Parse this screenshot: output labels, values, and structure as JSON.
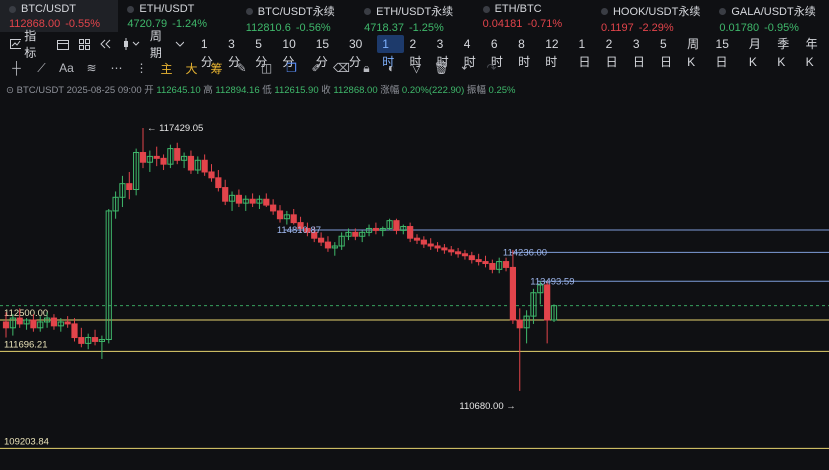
{
  "tickers": [
    {
      "symbol": "BTC/USDT",
      "price": "112868.00",
      "change": "-0.55%",
      "dir": "down",
      "active": true
    },
    {
      "symbol": "ETH/USDT",
      "price": "4720.79",
      "change": "-1.24%",
      "dir": "up",
      "active": false
    },
    {
      "symbol": "BTC/USDT永续",
      "price": "112810.6",
      "change": "-0.56%",
      "dir": "up",
      "active": false
    },
    {
      "symbol": "ETH/USDT永续",
      "price": "4718.37",
      "change": "-1.25%",
      "dir": "up",
      "active": false
    },
    {
      "symbol": "ETH/BTC",
      "price": "0.04181",
      "change": "-0.71%",
      "dir": "down",
      "active": false
    },
    {
      "symbol": "HOOK/USDT永续",
      "price": "0.1197",
      "change": "-2.29%",
      "dir": "down",
      "active": false
    },
    {
      "symbol": "GALA/USDT永续",
      "price": "0.01780",
      "change": "-0.95%",
      "dir": "up",
      "active": false
    }
  ],
  "periodbar": {
    "indicator_label": "指标",
    "period_label": "周期",
    "periods": [
      "1分",
      "3分",
      "5分",
      "10分",
      "15分",
      "30分",
      "1时",
      "2时",
      "3时",
      "4时",
      "6时",
      "8时",
      "12时",
      "1日",
      "2日",
      "3日",
      "5日",
      "周K",
      "15日",
      "月K",
      "季K",
      "年K"
    ],
    "active": "1时"
  },
  "toolbar": {
    "labels": [
      "Aa",
      "主",
      "大",
      "筹"
    ]
  },
  "ohlc": {
    "pair": "BTC/USDT",
    "time": "2025-08-25 09:00",
    "open_label": "开",
    "open": "112645.10",
    "high_label": "高",
    "high": "112894.16",
    "low_label": "低",
    "low": "112615.90",
    "close_label": "收",
    "close": "112868.00",
    "change_label": "涨幅",
    "change": "0.20%(222.90)",
    "amp_label": "振幅",
    "amp": "0.25%"
  },
  "chart_data": {
    "type": "candlestick",
    "ylim": [
      108650,
      118250
    ],
    "colors": {
      "up": "#3fb86b",
      "down": "#e2444b",
      "gold_line": "#e6d26f",
      "blue_line": "#7f9dd9"
    },
    "candles": [
      [
        112450,
        112700,
        112050,
        112300
      ],
      [
        112300,
        112650,
        112100,
        112550
      ],
      [
        112550,
        112800,
        112300,
        112400
      ],
      [
        112400,
        112550,
        112250,
        112500
      ],
      [
        112500,
        112650,
        112200,
        112300
      ],
      [
        112300,
        112600,
        112200,
        112450
      ],
      [
        112450,
        112700,
        112300,
        112550
      ],
      [
        112550,
        112650,
        112250,
        112350
      ],
      [
        112350,
        112550,
        112200,
        112450
      ],
      [
        112450,
        112600,
        112300,
        112400
      ],
      [
        112400,
        112550,
        111950,
        112050
      ],
      [
        112050,
        112300,
        111800,
        111900
      ],
      [
        111900,
        112150,
        111750,
        112050
      ],
      [
        112050,
        112250,
        111850,
        111950
      ],
      [
        111950,
        112100,
        111500,
        112000
      ],
      [
        112000,
        115350,
        111900,
        115300
      ],
      [
        115300,
        115800,
        115100,
        115650
      ],
      [
        115650,
        116200,
        115400,
        116000
      ],
      [
        116000,
        116300,
        115600,
        115850
      ],
      [
        115850,
        116900,
        115700,
        116800
      ],
      [
        116800,
        117429.05,
        116400,
        116550
      ],
      [
        116550,
        116850,
        116300,
        116700
      ],
      [
        116700,
        116950,
        116450,
        116650
      ],
      [
        116650,
        116750,
        116350,
        116500
      ],
      [
        116500,
        117000,
        116400,
        116900
      ],
      [
        116900,
        117050,
        116500,
        116600
      ],
      [
        116600,
        116800,
        116400,
        116700
      ],
      [
        116700,
        116850,
        116250,
        116350
      ],
      [
        116350,
        116700,
        116250,
        116600
      ],
      [
        116600,
        116750,
        116200,
        116300
      ],
      [
        116300,
        116500,
        116050,
        116150
      ],
      [
        116150,
        116350,
        115800,
        115900
      ],
      [
        115900,
        116100,
        115450,
        115550
      ],
      [
        115550,
        115800,
        115300,
        115700
      ],
      [
        115700,
        115850,
        115400,
        115500
      ],
      [
        115500,
        115700,
        115300,
        115600
      ],
      [
        115600,
        115750,
        115400,
        115500
      ],
      [
        115500,
        115700,
        115350,
        115600
      ],
      [
        115600,
        115750,
        115400,
        115450
      ],
      [
        115450,
        115600,
        115200,
        115300
      ],
      [
        115300,
        115450,
        115000,
        115100
      ],
      [
        115100,
        115300,
        114950,
        115200
      ],
      [
        115200,
        115350,
        114950,
        115000
      ],
      [
        115000,
        115150,
        114750,
        114850
      ],
      [
        114850,
        115000,
        114650,
        114750
      ],
      [
        114750,
        114900,
        114500,
        114600
      ],
      [
        114600,
        114750,
        114400,
        114500
      ],
      [
        114500,
        114650,
        114250,
        114350
      ],
      [
        114350,
        114500,
        114150,
        114400
      ],
      [
        114400,
        114750,
        114300,
        114650
      ],
      [
        114650,
        114850,
        114550,
        114750
      ],
      [
        114750,
        114850,
        114550,
        114650
      ],
      [
        114650,
        114800,
        114500,
        114750
      ],
      [
        114750,
        114950,
        114650,
        114850
      ],
      [
        114850,
        115000,
        114700,
        114800
      ],
      [
        114800,
        114900,
        114650,
        114850
      ],
      [
        114850,
        115100,
        114800,
        115050
      ],
      [
        115050,
        115100,
        114700,
        114800
      ],
      [
        114800,
        114950,
        114700,
        114900
      ],
      [
        114900,
        115000,
        114500,
        114600
      ],
      [
        114600,
        114700,
        114450,
        114550
      ],
      [
        114550,
        114650,
        114350,
        114450
      ],
      [
        114450,
        114600,
        114300,
        114400
      ],
      [
        114400,
        114500,
        114250,
        114350
      ],
      [
        114350,
        114450,
        114200,
        114300
      ],
      [
        114300,
        114400,
        114150,
        114250
      ],
      [
        114250,
        114350,
        114100,
        114200
      ],
      [
        114200,
        114300,
        114050,
        114150
      ],
      [
        114150,
        114250,
        113950,
        114050
      ],
      [
        114050,
        114200,
        113900,
        114000
      ],
      [
        114000,
        114150,
        113850,
        113950
      ],
      [
        113950,
        114050,
        113700,
        113800
      ],
      [
        113800,
        114100,
        113700,
        114000
      ],
      [
        114000,
        114100,
        113750,
        113850
      ],
      [
        113850,
        114300,
        112400,
        112500
      ],
      [
        112500,
        112800,
        110680,
        112300
      ],
      [
        112300,
        112750,
        111900,
        112600
      ],
      [
        112600,
        113300,
        112400,
        113200
      ],
      [
        113200,
        113493.59,
        112900,
        113400
      ],
      [
        113400,
        113493.59,
        111900,
        112500
      ],
      [
        112500,
        112900,
        112450,
        112868
      ]
    ],
    "annotations": [
      {
        "text": "117429.05",
        "price": 117429.05,
        "candle": 20,
        "side": "right"
      },
      {
        "text": "114810.87",
        "price": 114810.87,
        "candle": 41,
        "side": "left"
      },
      {
        "text": "114236.00",
        "price": 114236,
        "candle": 74,
        "side": "left"
      },
      {
        "text": "113493.59",
        "price": 113493.59,
        "candle": 78,
        "side": "left"
      },
      {
        "text": "110680.00",
        "price": 110680,
        "candle": 75,
        "side": "left-arrow"
      }
    ],
    "levels": [
      {
        "label": "112500.00",
        "price": 112500,
        "color": "#e6d26f"
      },
      {
        "label": "111696.21",
        "price": 111696.21,
        "color": "#e6d26f"
      },
      {
        "label": "109203.84",
        "price": 109203.84,
        "color": "#e6d26f"
      }
    ],
    "blue_lines": [
      114810.87,
      114236,
      113493.59
    ],
    "current_price": 112868
  }
}
